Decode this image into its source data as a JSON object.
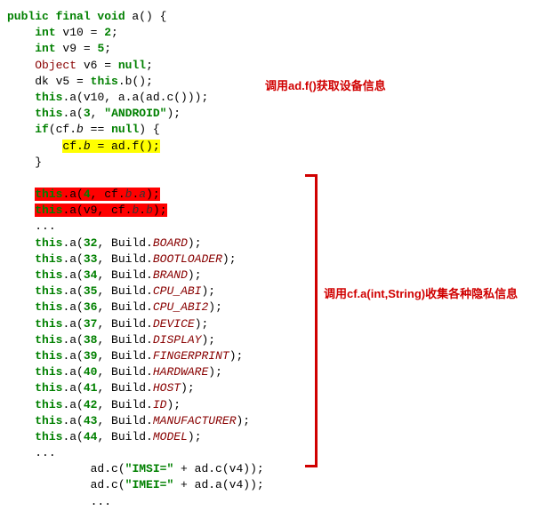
{
  "code": {
    "l1_kw1": "public final void",
    "l1_rest": " a() {",
    "l2_kw": "int",
    "l2_rest": " v10 = ",
    "l2_num": "2",
    "l2_end": ";",
    "l3_kw": "int",
    "l3_rest": " v9 = ",
    "l3_num": "5",
    "l3_end": ";",
    "l4_type": "Object",
    "l4_rest": " v6 = ",
    "l4_null": "null",
    "l4_end": ";",
    "l5_pre": "dk v5 = ",
    "l5_this": "this",
    "l5_rest": ".b();",
    "l6_this": "this",
    "l6_rest1": ".a(v10, a.a(ad.c()));",
    "l7_this": "this",
    "l7_rest1": ".a(",
    "l7_num": "3",
    "l7_rest2": ", ",
    "l7_str": "\"ANDROID\"",
    "l7_end": ");",
    "l8_kw": "if",
    "l8_rest1": "(cf.",
    "l8_ital": "b",
    "l8_rest2": " == ",
    "l8_null": "null",
    "l8_end": ") {",
    "l9_pre": "cf.",
    "l9_ital": "b",
    "l9_rest": " = ad.f();",
    "l10": "}",
    "l11_this": "this",
    "l11_rest1": ".a(",
    "l11_num": "4",
    "l11_rest2": ", cf.",
    "l11_ital1": "b",
    "l11_rest3": ".",
    "l11_ital2": "a",
    "l11_end": ");",
    "l12_this": "this",
    "l12_rest1": ".a(v9, cf.",
    "l12_ital1": "b",
    "l12_rest2": ".",
    "l12_ital2": "b",
    "l12_end": ");",
    "dots": "...",
    "builds": [
      {
        "n": "32",
        "f": "BOARD"
      },
      {
        "n": "33",
        "f": "BOOTLOADER"
      },
      {
        "n": "34",
        "f": "BRAND"
      },
      {
        "n": "35",
        "f": "CPU_ABI"
      },
      {
        "n": "36",
        "f": "CPU_ABI2"
      },
      {
        "n": "37",
        "f": "DEVICE"
      },
      {
        "n": "38",
        "f": "DISPLAY"
      },
      {
        "n": "39",
        "f": "FINGERPRINT"
      },
      {
        "n": "40",
        "f": "HARDWARE"
      },
      {
        "n": "41",
        "f": "HOST"
      },
      {
        "n": "42",
        "f": "ID"
      },
      {
        "n": "43",
        "f": "MANUFACTURER"
      },
      {
        "n": "44",
        "f": "MODEL"
      }
    ],
    "build_this": "this",
    "build_pre": ".a(",
    "build_mid": ", Build.",
    "build_end": ");",
    "imsi_pre": "ad.c(",
    "imsi_str": "\"IMSI=\"",
    "imsi_rest": " + ad.c(v4));",
    "imei_pre": "ad.c(",
    "imei_str": "\"IMEI=\"",
    "imei_rest": " + ad.a(v4));"
  },
  "annotations": {
    "a1": "调用ad.f()获取设备信息",
    "a2": "调用cf.a(int,String)收集各种隐私信息"
  }
}
